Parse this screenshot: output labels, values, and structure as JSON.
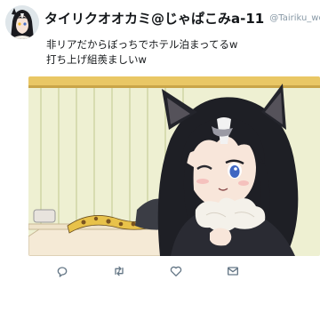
{
  "tweet": {
    "display_name": "タイリクオオカミ@じゃぱこみa-11",
    "handle": "@Tairiku_wolf",
    "text_lines": [
      "非リアだからぼっちでホテル泊まってるw",
      "打ち上げ組羨ましいw"
    ]
  },
  "icons": {
    "avatar": "avatar-image",
    "media": "anime-wolf-girl-illustration",
    "reply": "reply-icon",
    "retweet": "retweet-icon",
    "like": "heart-icon",
    "message": "envelope-icon"
  },
  "colors": {
    "name": "#14171a",
    "handle": "#8899a6",
    "action_icon": "#657786",
    "wall": "#e8ecc8",
    "wood_trim": "#e6c25a"
  }
}
